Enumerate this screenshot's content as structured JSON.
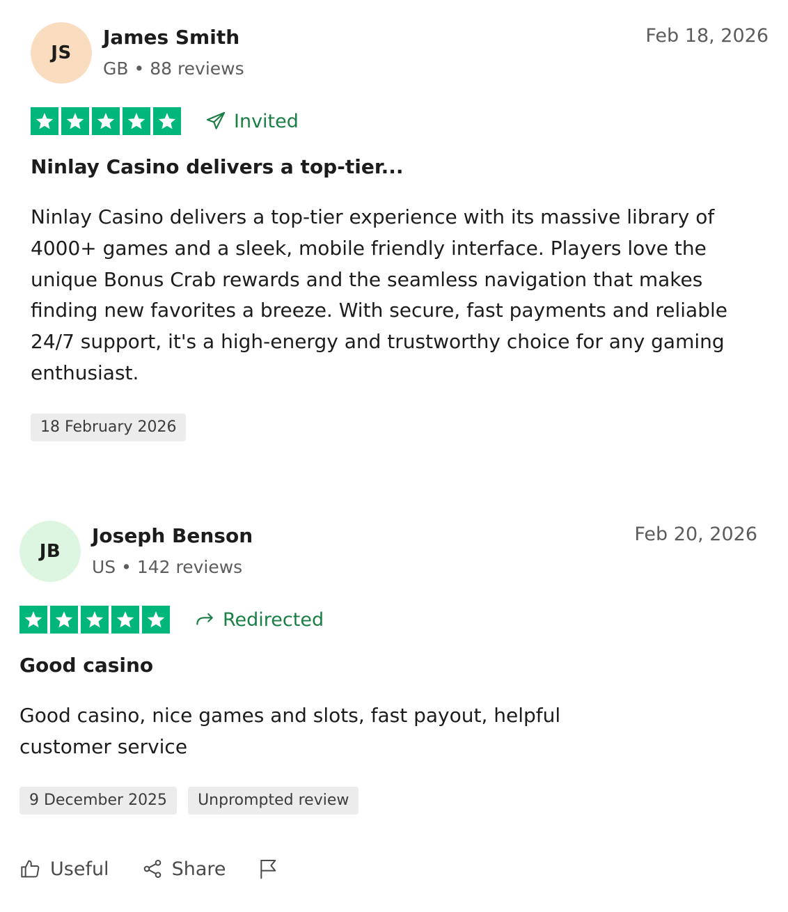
{
  "reviews": [
    {
      "initials": "JS",
      "avatar_color": "#fadcbf",
      "name": "James Smith",
      "country": "GB",
      "separator": "•",
      "review_count": "88 reviews",
      "date": "Feb 18, 2026",
      "rating": 5,
      "source_label": "Invited",
      "source_icon": "paper-plane-icon",
      "title": "Ninlay Casino delivers a top-tier...",
      "text": "Ninlay Casino delivers a top-tier experience with its massive library of 4000+ games and a sleek, mobile friendly interface. Players love the unique Bonus Crab rewards and the seamless navigation that makes finding new favorites a breeze. With secure, fast payments and reliable 24/7 support, it's a high-energy and trustworthy choice for any gaming enthusiast.",
      "tags": [
        "18 February 2026"
      ]
    },
    {
      "initials": "JB",
      "avatar_color": "#dcf6e2",
      "name": "Joseph Benson",
      "country": "US",
      "separator": "•",
      "review_count": "142 reviews",
      "date": "Feb 20, 2026",
      "rating": 5,
      "source_label": "Redirected",
      "source_icon": "redirect-arrow-icon",
      "title": "Good casino",
      "text": "Good casino, nice games and slots, fast payout, helpful customer service",
      "tags": [
        "9 December 2025",
        "Unprompted review"
      ]
    }
  ],
  "actions": {
    "useful_label": "Useful",
    "share_label": "Share",
    "report_icon": "flag-icon"
  },
  "colors": {
    "star_green": "#00b67a",
    "source_green": "#1a7f45",
    "tag_background": "#ececec"
  }
}
